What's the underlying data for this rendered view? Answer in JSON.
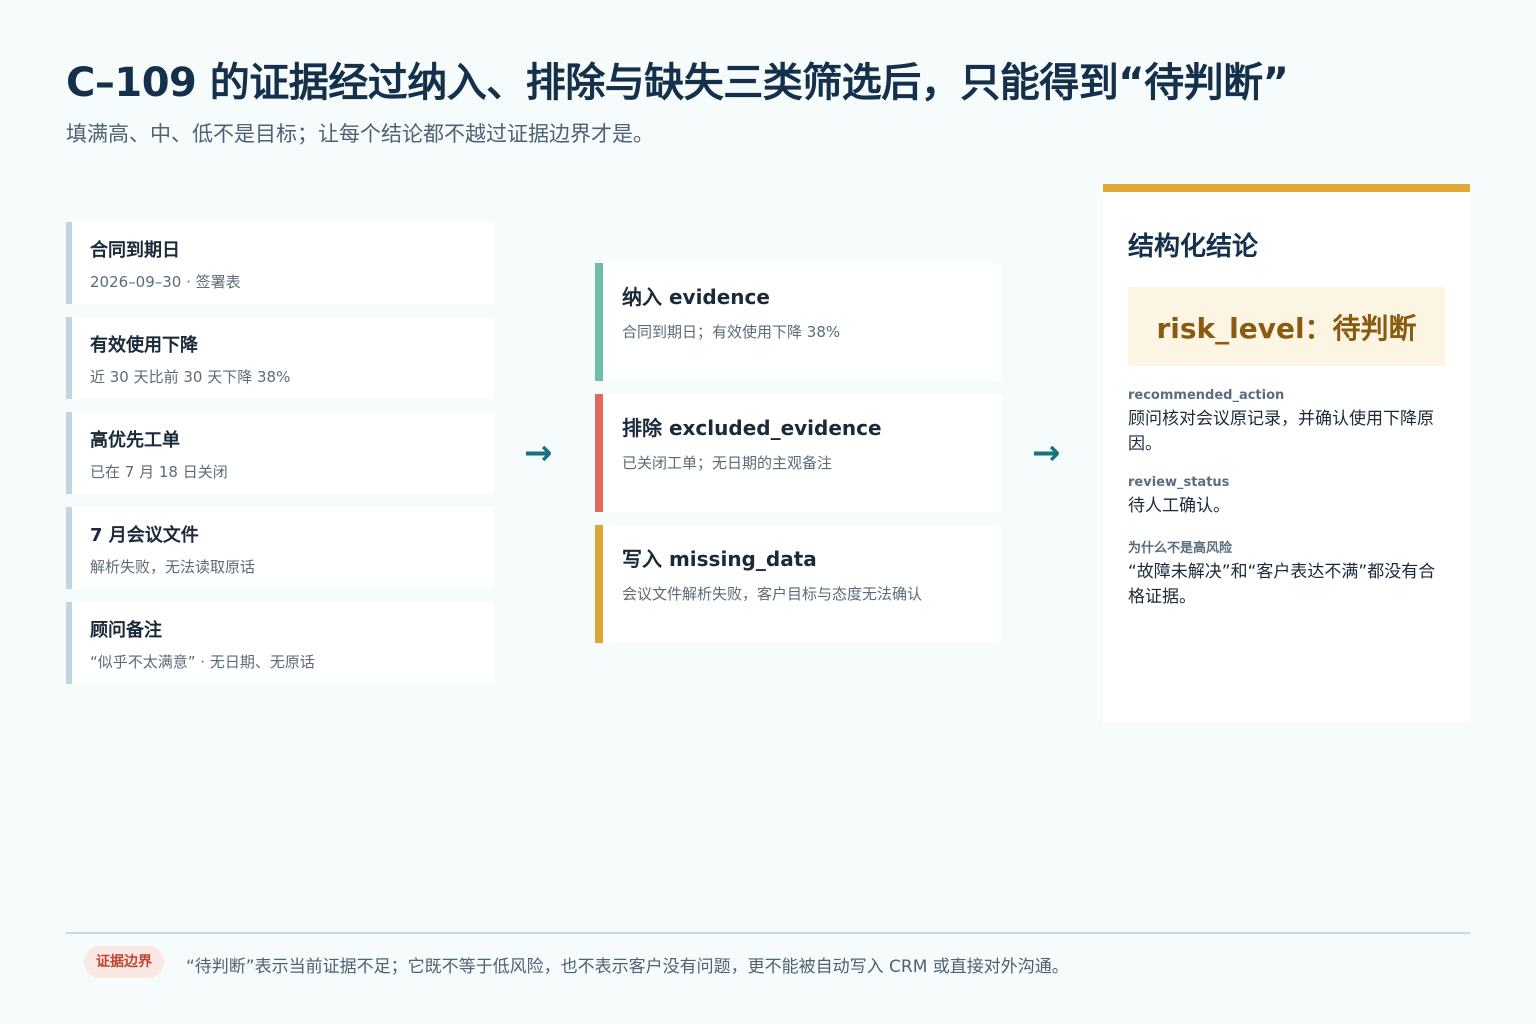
{
  "header": {
    "title": "C–109 的证据经过纳入、排除与缺失三类筛选后，只能得到“待判断”",
    "subtitle": "填满高、中、低不是目标；让每个结论都不越过证据边界才是。"
  },
  "sources": [
    {
      "title": "合同到期日",
      "detail": "2026–09–30 · 签署表"
    },
    {
      "title": "有效使用下降",
      "detail": "近 30 天比前 30 天下降 38%"
    },
    {
      "title": "高优先工单",
      "detail": "已在 7 月 18 日关闭"
    },
    {
      "title": "7 月会议文件",
      "detail": "解析失败，无法读取原话"
    },
    {
      "title": "顾问备注",
      "detail": "“似乎不太满意” · 无日期、无原话"
    }
  ],
  "arrows": {
    "first": "→",
    "second": "→"
  },
  "buckets": [
    {
      "title": "纳入 evidence",
      "detail": "合同到期日；有效使用下降 38%",
      "color": "#6fbcaa"
    },
    {
      "title": "排除 excluded_evidence",
      "detail": "已关闭工单；无日期的主观备注",
      "color": "#e06a5a"
    },
    {
      "title": "写入 missing_data",
      "detail": "会议文件解析失败，客户目标与态度无法确认",
      "color": "#dca534"
    }
  ],
  "result": {
    "heading": "结构化结论",
    "risk_level": "risk_level：待判断",
    "fields": [
      {
        "key": "recommended_action",
        "value": "顾问核对会议原记录，并确认使用下降原因。"
      },
      {
        "key": "review_status",
        "value": "待人工确认。"
      },
      {
        "key": "为什么不是高风险",
        "value": "“故障未解决”和“客户表达不满”都没有合格证据。"
      }
    ]
  },
  "footer": {
    "badge": "证据边界",
    "note": "“待判断”表示当前证据不足；它既不等于低风险，也不表示客户没有问题，更不能被自动写入 CRM 或直接对外沟通。"
  },
  "colors": {
    "accent": "#16727e",
    "panel_top": "#dfa837",
    "badge_text": "#c3432f"
  }
}
